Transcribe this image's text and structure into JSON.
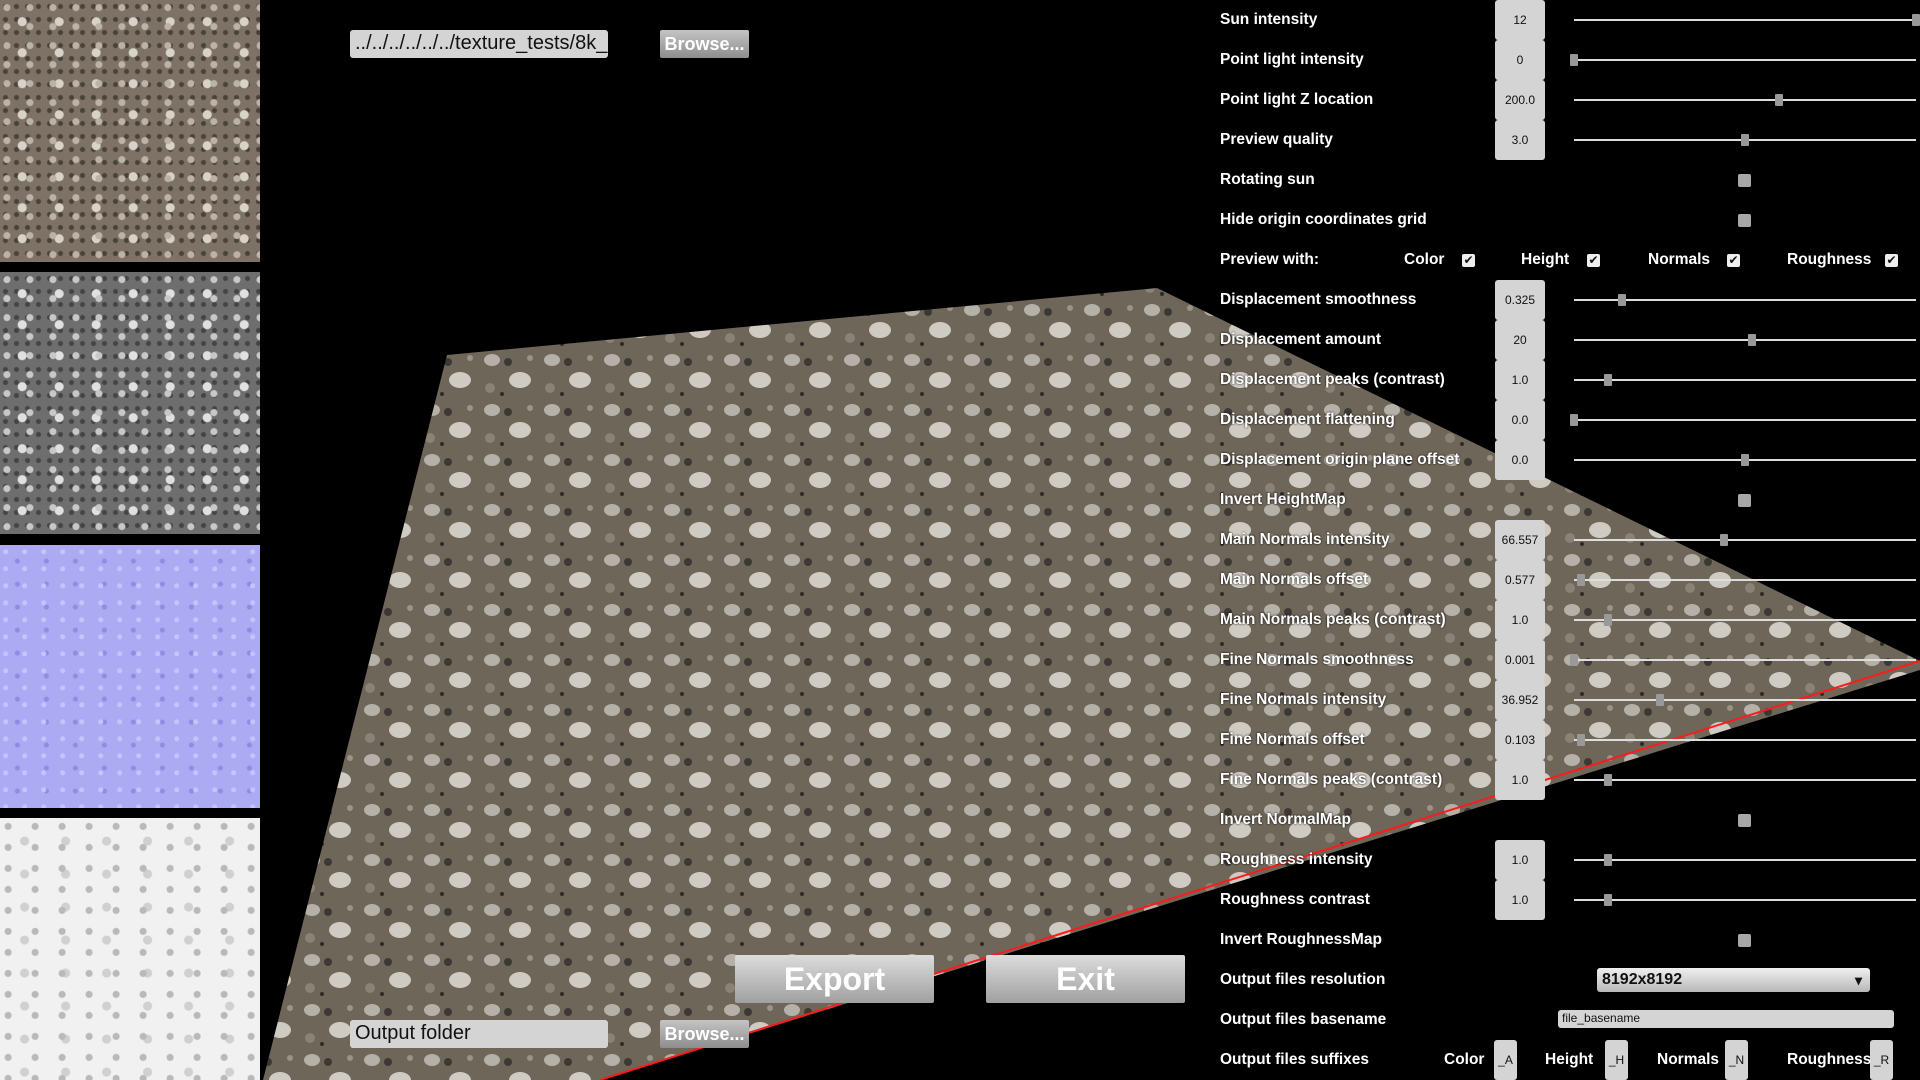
{
  "thumbnails": [
    {
      "name": "color"
    },
    {
      "name": "height"
    },
    {
      "name": "normals"
    },
    {
      "name": "roughness"
    }
  ],
  "top": {
    "path_value": "../../../../../../texture_tests/8k_",
    "browse_label": "Browse..."
  },
  "bottom": {
    "output_folder_placeholder": "Output folder",
    "browse_label": "Browse...",
    "export_label": "Export",
    "exit_label": "Exit"
  },
  "colors": {
    "grid_line": "#ff1a1a",
    "panel_field": "#d4d4d4"
  },
  "settings": [
    {
      "label": "Sun intensity",
      "type": "slider",
      "value": "12",
      "level": 1.0
    },
    {
      "label": "Point light intensity",
      "type": "slider",
      "value": "0",
      "level": 0.0
    },
    {
      "label": "Point light Z location",
      "type": "slider",
      "value": "200.0",
      "level": 0.6
    },
    {
      "label": "Preview quality",
      "type": "slider",
      "value": "3.0",
      "level": 0.5
    },
    {
      "label": "Rotating sun",
      "type": "checkbox",
      "checked": false
    },
    {
      "label": "Hide origin coordinates grid",
      "type": "checkbox",
      "checked": false
    },
    {
      "label": "Preview with:",
      "type": "multi",
      "options": [
        {
          "label": "Color",
          "checked": true
        },
        {
          "label": "Height",
          "checked": true
        },
        {
          "label": "Normals",
          "checked": true
        },
        {
          "label": "Roughness",
          "checked": true
        }
      ]
    },
    {
      "label": "Displacement smoothness",
      "type": "slider",
      "value": "0.325",
      "level": 0.14
    },
    {
      "label": "Displacement amount",
      "type": "slider",
      "value": "20",
      "level": 0.52
    },
    {
      "label": "Displacement peaks (contrast)",
      "type": "slider",
      "value": "1.0",
      "level": 0.1
    },
    {
      "label": "Displacement flattening",
      "type": "slider",
      "value": "0.0",
      "level": 0.0
    },
    {
      "label": "Displacement origin plane offset",
      "type": "slider",
      "value": "0.0",
      "level": 0.5
    },
    {
      "label": "Invert HeightMap",
      "type": "checkbox",
      "checked": false
    },
    {
      "label": "Main Normals intensity",
      "type": "slider",
      "value": "66.557",
      "level": 0.44
    },
    {
      "label": "Main Normals offset",
      "type": "slider",
      "value": "0.577",
      "level": 0.02
    },
    {
      "label": "Main Normals peaks (contrast)",
      "type": "slider",
      "value": "1.0",
      "level": 0.1
    },
    {
      "label": "Fine Normals smoothness",
      "type": "slider",
      "value": "0.001",
      "level": 0.0
    },
    {
      "label": "Fine Normals intensity",
      "type": "slider",
      "value": "36.952",
      "level": 0.25
    },
    {
      "label": "Fine Normals offset",
      "type": "slider",
      "value": "0.103",
      "level": 0.02
    },
    {
      "label": "Fine Normals peaks (contrast)",
      "type": "slider",
      "value": "1.0",
      "level": 0.1
    },
    {
      "label": "Invert NormalMap",
      "type": "checkbox",
      "checked": false
    },
    {
      "label": "Roughness intensity",
      "type": "slider",
      "value": "1.0",
      "level": 0.1
    },
    {
      "label": "Roughness contrast",
      "type": "slider",
      "value": "1.0",
      "level": 0.1
    },
    {
      "label": "Invert RoughnessMap",
      "type": "checkbox",
      "checked": false
    },
    {
      "label": "Output files resolution",
      "type": "select",
      "value": "8192x8192"
    },
    {
      "label": "Output files basename",
      "type": "text",
      "value": "file_basename"
    },
    {
      "label": "Output files suffixes",
      "type": "suffixes",
      "options": [
        {
          "label": "Color",
          "value": "_A"
        },
        {
          "label": "Height",
          "value": "_H"
        },
        {
          "label": "Normals",
          "value": "_N"
        },
        {
          "label": "Roughness",
          "value": "_R"
        }
      ]
    }
  ]
}
